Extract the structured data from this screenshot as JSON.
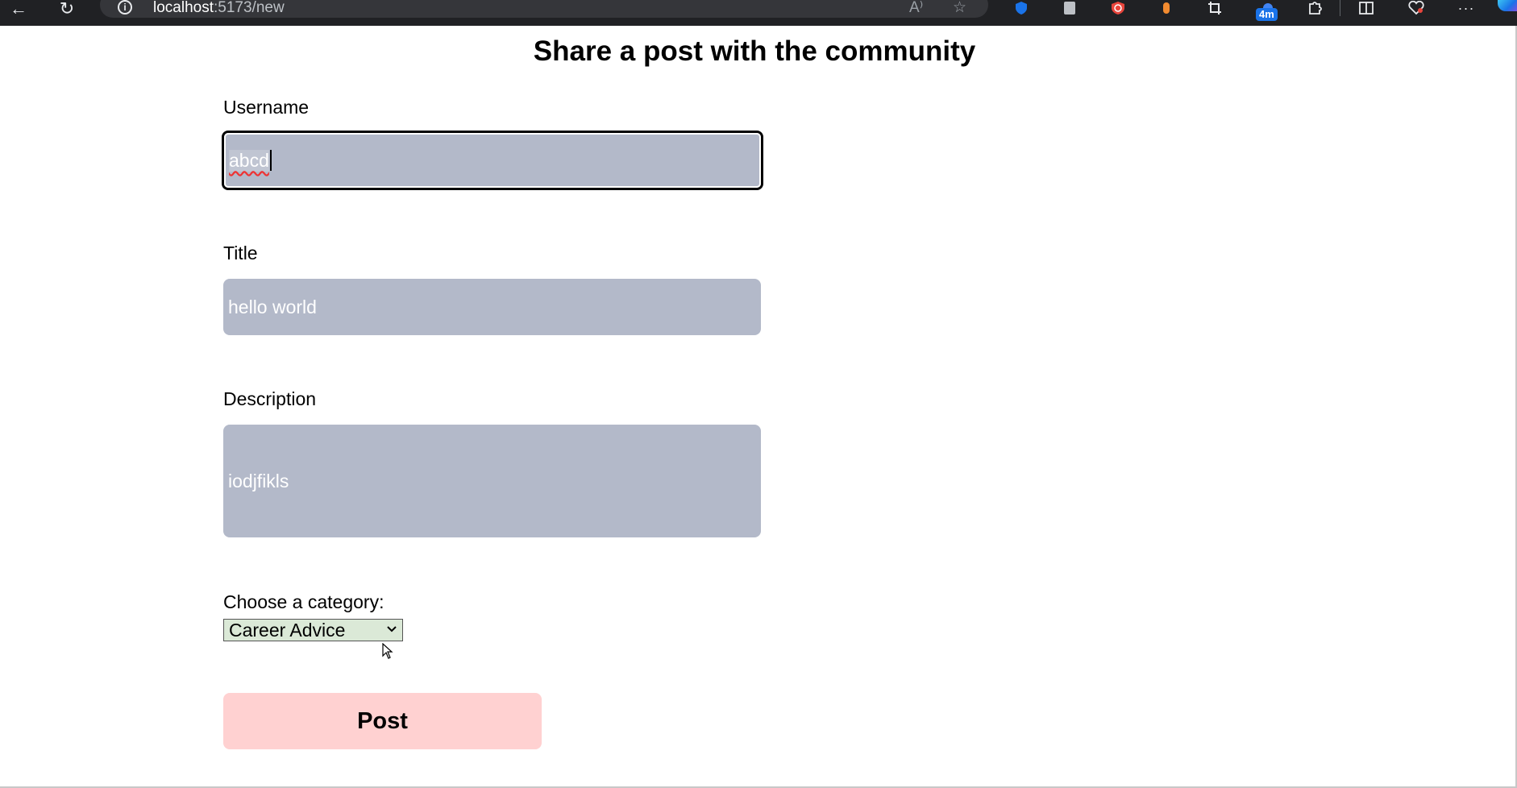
{
  "browser": {
    "url_host": "localhost",
    "url_path": ":5173/new",
    "icons": {
      "back": "←",
      "reload": "↻",
      "info": "i",
      "read_aloud": "A⁾",
      "favorite": "☆",
      "more": "···"
    },
    "tab_badge": "4m"
  },
  "page": {
    "title": "Share a post with the community"
  },
  "form": {
    "username": {
      "label": "Username",
      "value": "abcd"
    },
    "title": {
      "label": "Title",
      "value": "hello world"
    },
    "description": {
      "label": "Description",
      "value": "iodjfikls"
    },
    "category": {
      "label": "Choose a category:",
      "selected": "Career Advice"
    },
    "submit_label": "Post"
  },
  "colors": {
    "field_bg": "#b3b9c9",
    "select_bg": "#dbe9d7",
    "button_bg": "#ffd1d1",
    "chrome_bg": "#202124"
  }
}
